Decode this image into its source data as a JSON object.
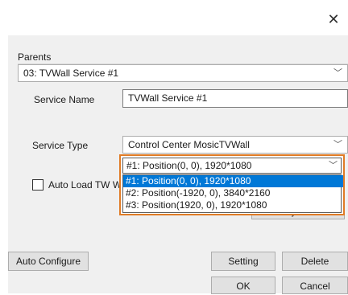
{
  "window": {
    "close_glyph": "✕"
  },
  "parents": {
    "group_label": "Parents",
    "selected": "03: TVWall Service #1"
  },
  "service_name": {
    "label": "Service Name",
    "value": "TVWall Service #1"
  },
  "service_type": {
    "label": "Service Type",
    "selected": "Control Center MosicTVWall"
  },
  "auto_load": {
    "label": "Auto Load TW W",
    "checked": false
  },
  "monitor_dropdown": {
    "selected": "#1: Position(0, 0), 1920*1080",
    "options": [
      "#1: Position(0, 0), 1920*1080",
      "#2: Position(-1920, 0), 3840*2160",
      "#3: Position(1920, 0), 1920*1080"
    ],
    "highlighted_index": 0,
    "highlight_color": "#e07b25"
  },
  "buttons": {
    "identify_monitor": "Identify Monitor",
    "auto_configure": "Auto Configure",
    "setting": "Setting",
    "delete": "Delete",
    "ok": "OK",
    "cancel": "Cancel"
  },
  "colors": {
    "selection": "#0078d7",
    "dialog_bg": "#f0f0f0"
  }
}
